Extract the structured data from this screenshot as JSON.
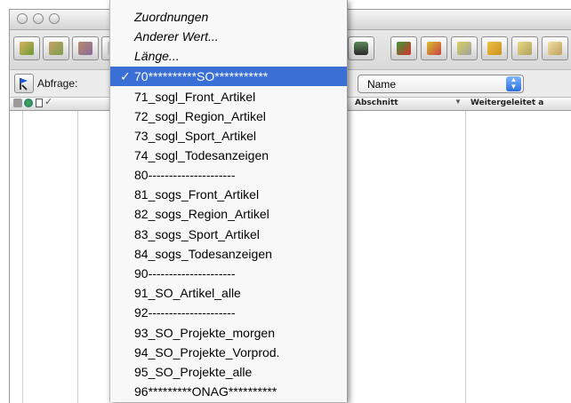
{
  "window": {
    "title": "*****"
  },
  "query": {
    "label": "Abfrage:",
    "field_value": "Name"
  },
  "columns": {
    "abschnitt": "Abschnitt",
    "weitergeleitet": "Weitergeleitet a"
  },
  "menu": {
    "items": [
      {
        "label": "Zuordnungen",
        "italic": true
      },
      {
        "label": "Anderer Wert...",
        "italic": true
      },
      {
        "label": "Länge...",
        "italic": true
      },
      {
        "label": "70**********SO***********",
        "selected": true,
        "check": "✓"
      },
      {
        "label": "71_sogl_Front_Artikel"
      },
      {
        "label": "72_sogl_Region_Artikel"
      },
      {
        "label": "73_sogl_Sport_Artikel"
      },
      {
        "label": "74_sogl_Todesanzeigen"
      },
      {
        "label": "80---------------------"
      },
      {
        "label": "81_sogs_Front_Artikel"
      },
      {
        "label": "82_sogs_Region_Artikel"
      },
      {
        "label": "83_sogs_Sport_Artikel"
      },
      {
        "label": "84_sogs_Todesanzeigen"
      },
      {
        "label": "90---------------------"
      },
      {
        "label": "91_SO_Artikel_alle"
      },
      {
        "label": "92---------------------"
      },
      {
        "label": "93_SO_Projekte_morgen"
      },
      {
        "label": "94_SO_Projekte_Vorprod."
      },
      {
        "label": "95_SO_Projekte_alle"
      },
      {
        "label": "96*********ONAG**********"
      }
    ]
  },
  "colors": {
    "selection": "#3a6fd6",
    "select_arrow": "#2a6fdc"
  }
}
